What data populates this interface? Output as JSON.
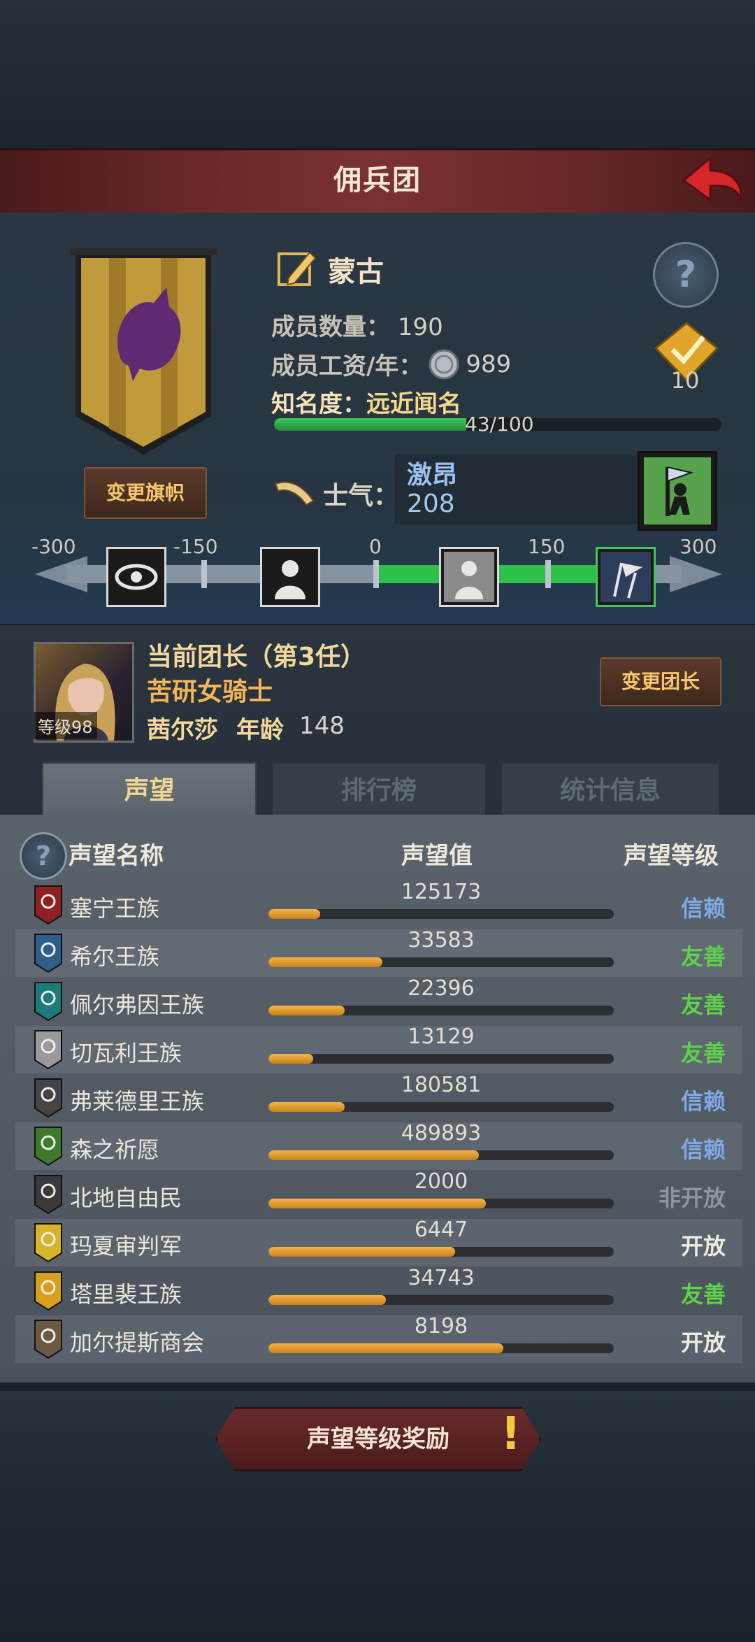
{
  "header": {
    "title": "佣兵团"
  },
  "company": {
    "name": "蒙古",
    "members_label": "成员数量：",
    "members": "190",
    "wage_label": "成员工资/年：",
    "wage": "989",
    "fame_label": "知名度：",
    "fame_value": "远近闻名",
    "fame_progress": "43/100",
    "fame_fraction": 0.43,
    "badge_count": "10",
    "change_banner_label": "变更旗帜"
  },
  "morale": {
    "label": "士气：",
    "state": "激昂",
    "value": "208",
    "scale_labels": [
      "-300",
      "-150",
      "0",
      "150",
      "300"
    ]
  },
  "leader": {
    "title": "当前团长（第3任）",
    "class": "苦研女骑士",
    "name": "茜尔莎",
    "age_label": "年龄",
    "age": "148",
    "level_label": "等级98",
    "change_label": "变更团长"
  },
  "tabs": [
    {
      "label": "声望"
    },
    {
      "label": "排行榜"
    },
    {
      "label": "统计信息"
    }
  ],
  "reputation": {
    "col_name": "声望名称",
    "col_value": "声望值",
    "col_level": "声望等级",
    "rows": [
      {
        "name": "塞宁王族",
        "value": "125173",
        "level": "信赖",
        "fill": 0.15,
        "icon": "red-crest-icon"
      },
      {
        "name": "希尔王族",
        "value": "33583",
        "level": "友善",
        "fill": 0.33,
        "icon": "blue-crest-icon"
      },
      {
        "name": "佩尔弗因王族",
        "value": "22396",
        "level": "友善",
        "fill": 0.22,
        "icon": "teal-crest-icon"
      },
      {
        "name": "切瓦利王族",
        "value": "13129",
        "level": "友善",
        "fill": 0.13,
        "icon": "scales-crest-icon"
      },
      {
        "name": "弗莱德里王族",
        "value": "180581",
        "level": "信赖",
        "fill": 0.22,
        "icon": "wolf-crest-icon"
      },
      {
        "name": "森之祈愿",
        "value": "489893",
        "level": "信赖",
        "fill": 0.61,
        "icon": "tree-crest-icon"
      },
      {
        "name": "北地自由民",
        "value": "2000",
        "level": "非开放",
        "fill": 0.63,
        "icon": "axe-crest-icon"
      },
      {
        "name": "玛夏审判军",
        "value": "6447",
        "level": "开放",
        "fill": 0.54,
        "icon": "sun-crest-icon"
      },
      {
        "name": "塔里裴王族",
        "value": "34743",
        "level": "友善",
        "fill": 0.34,
        "icon": "flame-crest-icon"
      },
      {
        "name": "加尔提斯商会",
        "value": "8198",
        "level": "开放",
        "fill": 0.68,
        "icon": "chest-crest-icon"
      }
    ]
  },
  "reward_button": {
    "label": "声望等级奖励"
  },
  "colors": {
    "trust": "#7fa9e6",
    "friendly": "#5fd24a",
    "closed": "#8a96a2",
    "open": "#f0ebe0"
  }
}
